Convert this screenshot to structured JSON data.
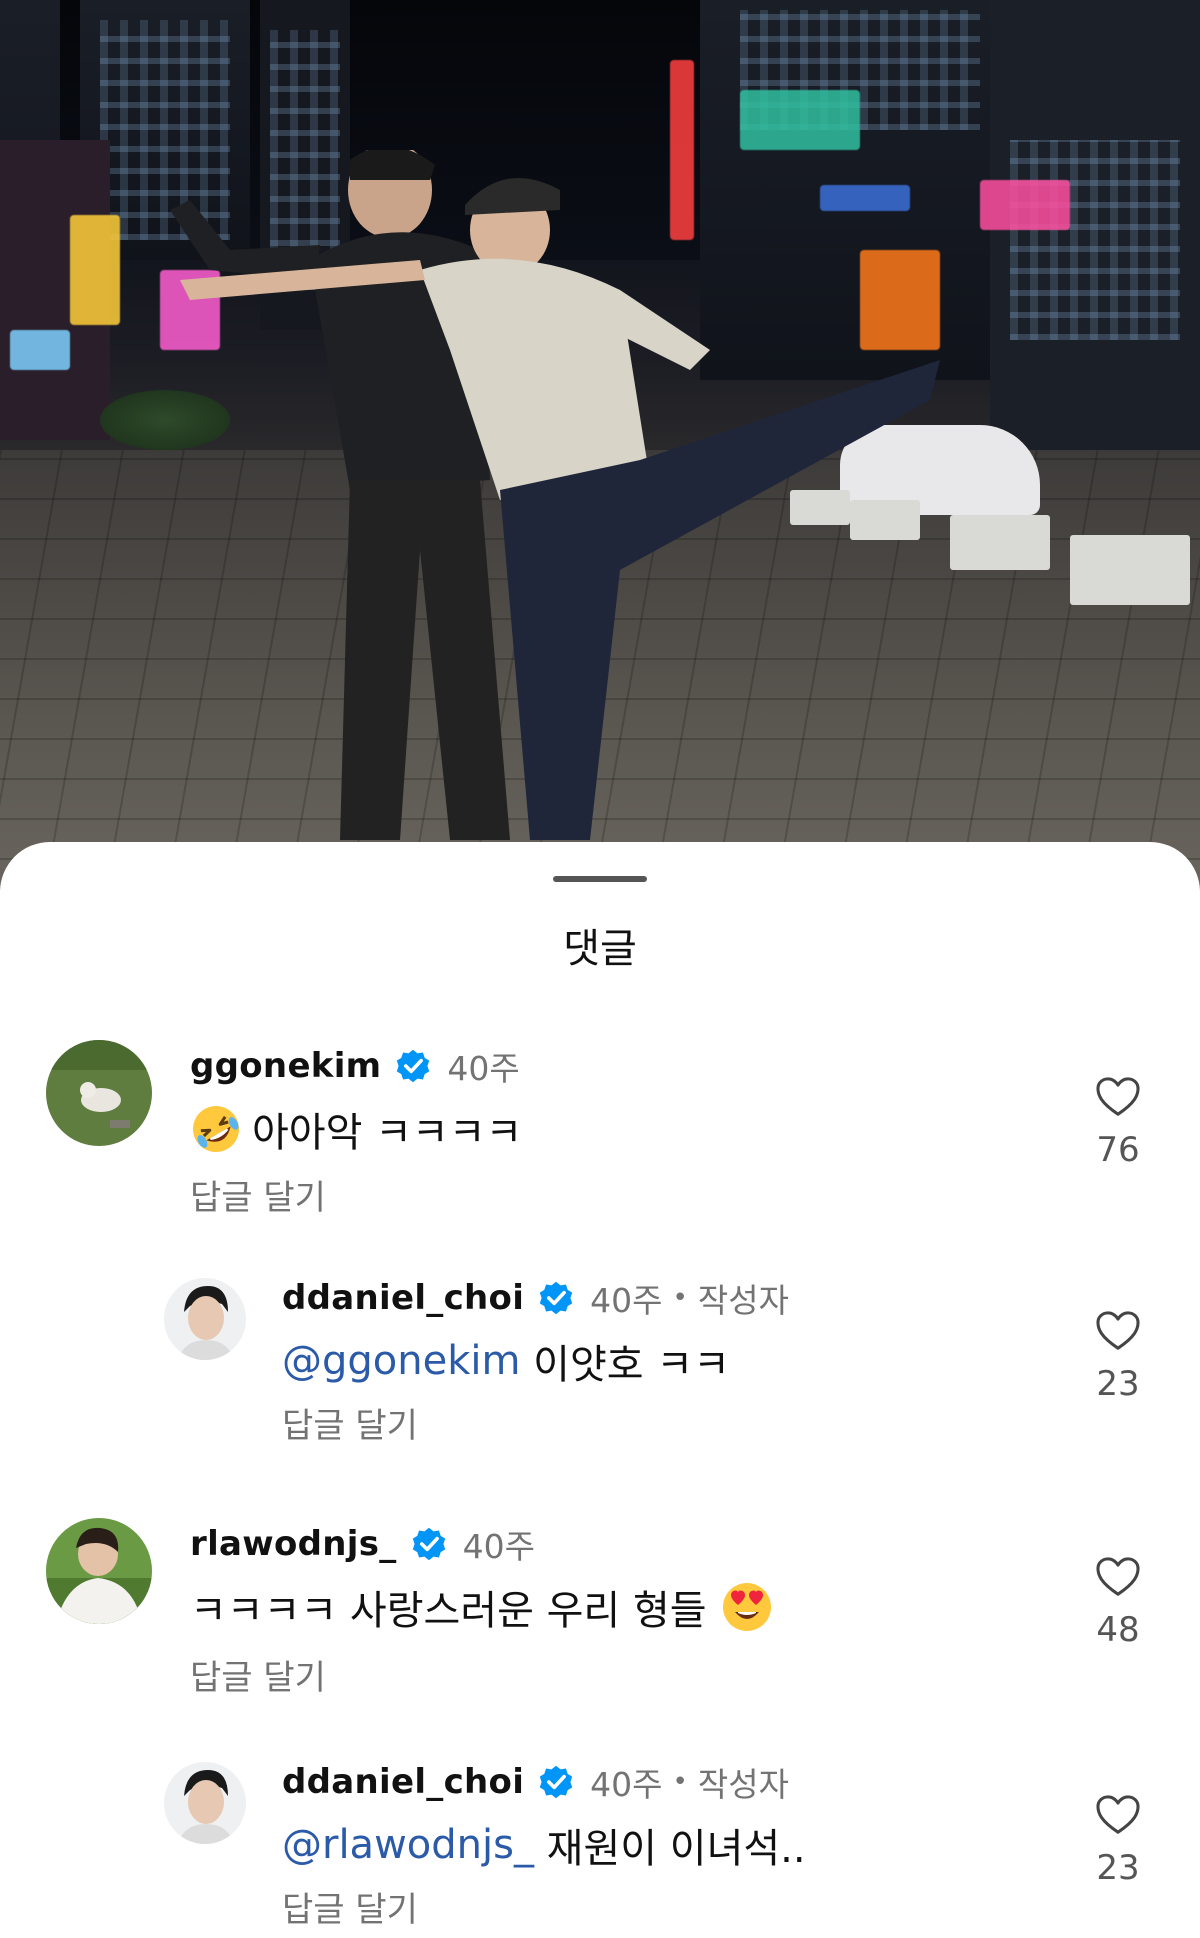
{
  "sheet": {
    "title": "댓글"
  },
  "colors": {
    "verified": "#0095f6",
    "mention": "#2b5aa8",
    "meta": "#737373"
  },
  "comments": [
    {
      "username": "ggonekim",
      "time": "40주",
      "author_tag": "",
      "emoji_before": "rolling-on-floor-laughing",
      "mention": "",
      "text": "아아악 ㅋㅋㅋㅋ",
      "reply_label": "답글 달기",
      "likes": "76",
      "is_reply": false
    },
    {
      "username": "ddaniel_choi",
      "time": "40주",
      "author_tag": "작성자",
      "mention": "@ggonekim",
      "text": " 이얏호 ㅋㅋ",
      "reply_label": "답글 달기",
      "likes": "23",
      "is_reply": true
    },
    {
      "username": "rlawodnjs_",
      "time": "40주",
      "author_tag": "",
      "mention": "",
      "text": "ㅋㅋㅋㅋ 사랑스러운 우리 형들",
      "emoji_after": "heart-eyes",
      "reply_label": "답글 달기",
      "likes": "48",
      "is_reply": false
    },
    {
      "username": "ddaniel_choi",
      "time": "40주",
      "author_tag": "작성자",
      "mention": "@rlawodnjs_",
      "text": " 재원이 이녀석..",
      "reply_label": "답글 달기",
      "likes": "23",
      "is_reply": true
    }
  ]
}
